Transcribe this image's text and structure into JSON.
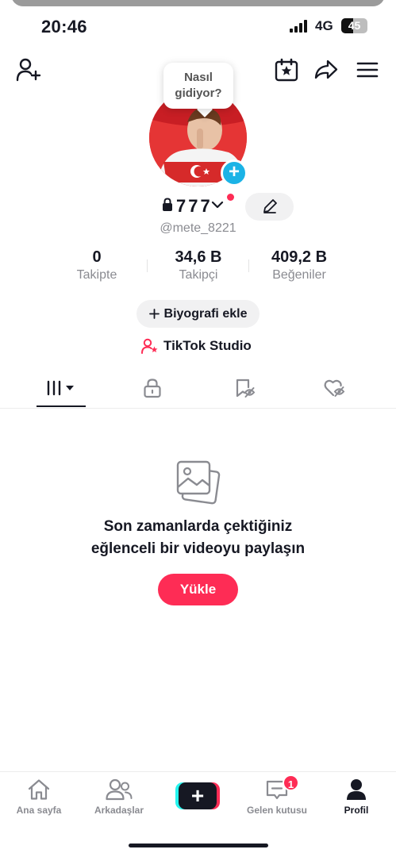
{
  "status_bar": {
    "time": "20:46",
    "network": "4G",
    "battery": "45",
    "battery_level": 0.45
  },
  "header": {
    "add_friend_icon": "person-plus-icon",
    "calendar_icon": "calendar-star-icon",
    "share_icon": "share-arrow-icon",
    "menu_icon": "hamburger-menu-icon"
  },
  "profile": {
    "bubble_text": "Nasıl gidiyor?",
    "display_name": "777",
    "username": "@mete_8221"
  },
  "stats": [
    {
      "value": "0",
      "label": "Takipte"
    },
    {
      "value": "34,6 B",
      "label": "Takipçi"
    },
    {
      "value": "409,2 B",
      "label": "Beğeniler"
    }
  ],
  "actions": {
    "bio_label": "Biyografi ekle",
    "studio_label": "TikTok Studio"
  },
  "tabs": [
    "videos-grid-icon",
    "lock-icon",
    "bookmark-hidden-icon",
    "heart-hidden-icon"
  ],
  "empty_state": {
    "line1": "Son zamanlarda çektiğiniz",
    "line2": "eğlenceli bir videoyu paylaşın",
    "button": "Yükle"
  },
  "bottom_nav": {
    "home": "Ana sayfa",
    "friends": "Arkadaşlar",
    "create": "+",
    "inbox": "Gelen kutusu",
    "inbox_badge": "1",
    "profile": "Profil"
  },
  "colors": {
    "accent": "#fe2c55",
    "cyan": "#25f4ee",
    "plus_blue": "#1bb3e6",
    "text": "#161823",
    "muted": "#8a8b91"
  }
}
